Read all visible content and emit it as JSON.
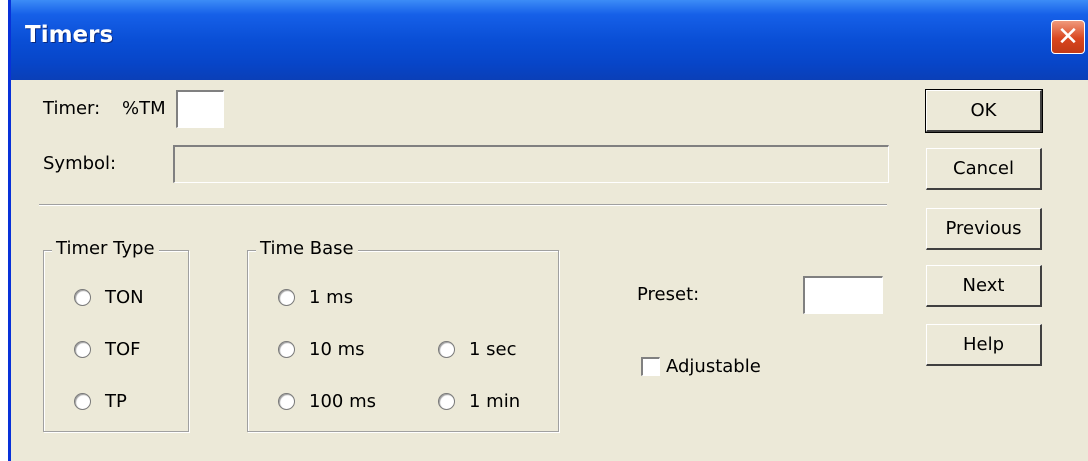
{
  "window": {
    "title": "Timers",
    "close_icon": "close-icon"
  },
  "timer": {
    "label": "Timer:",
    "prefix": "%TM",
    "value": ""
  },
  "symbol": {
    "label": "Symbol:",
    "value": ""
  },
  "timer_type": {
    "legend": "Timer Type",
    "options": [
      "TON",
      "TOF",
      "TP"
    ]
  },
  "time_base": {
    "legend": "Time Base",
    "options": [
      "1 ms",
      "10 ms",
      "100 ms",
      "1 sec",
      "1 min"
    ]
  },
  "preset": {
    "label": "Preset:",
    "value": ""
  },
  "adjustable": {
    "label": "Adjustable",
    "checked": false
  },
  "buttons": {
    "ok": "OK",
    "cancel": "Cancel",
    "previous": "Previous",
    "next": "Next",
    "help": "Help"
  },
  "colors": {
    "titlebar": "#0a4fd6",
    "dialog_bg": "#ece9d8",
    "close_button": "#d9461f"
  }
}
